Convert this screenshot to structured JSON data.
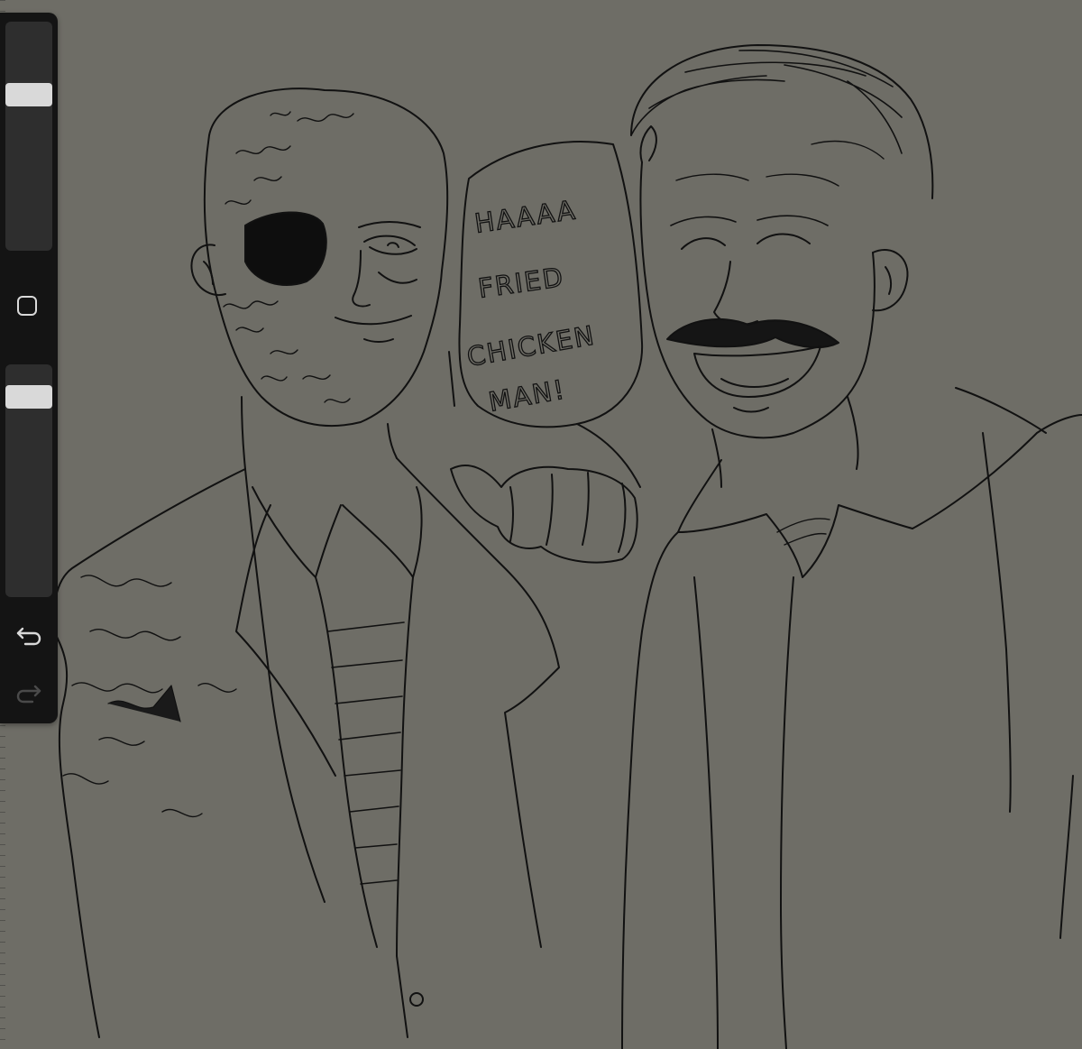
{
  "toolbar": {
    "size_slider": {
      "level": 0.7
    },
    "opacity_slider": {
      "level": 0.9
    },
    "buttons": [
      {
        "id": "modify",
        "icon": "square-icon"
      },
      {
        "id": "undo",
        "icon": "undo-arrow-icon"
      },
      {
        "id": "redo",
        "icon": "redo-arrow-icon",
        "enabled": false
      }
    ],
    "colors": {
      "panel": "#141414",
      "track": "#2e2e2e",
      "thumb": "#d9d9d9"
    }
  },
  "canvas": {
    "background": "#6e6d66",
    "line_color": "#111111",
    "speech_bubble": {
      "lines": [
        "HAAAA",
        "FRIED",
        "CHICKEN",
        "MAN!"
      ]
    }
  }
}
